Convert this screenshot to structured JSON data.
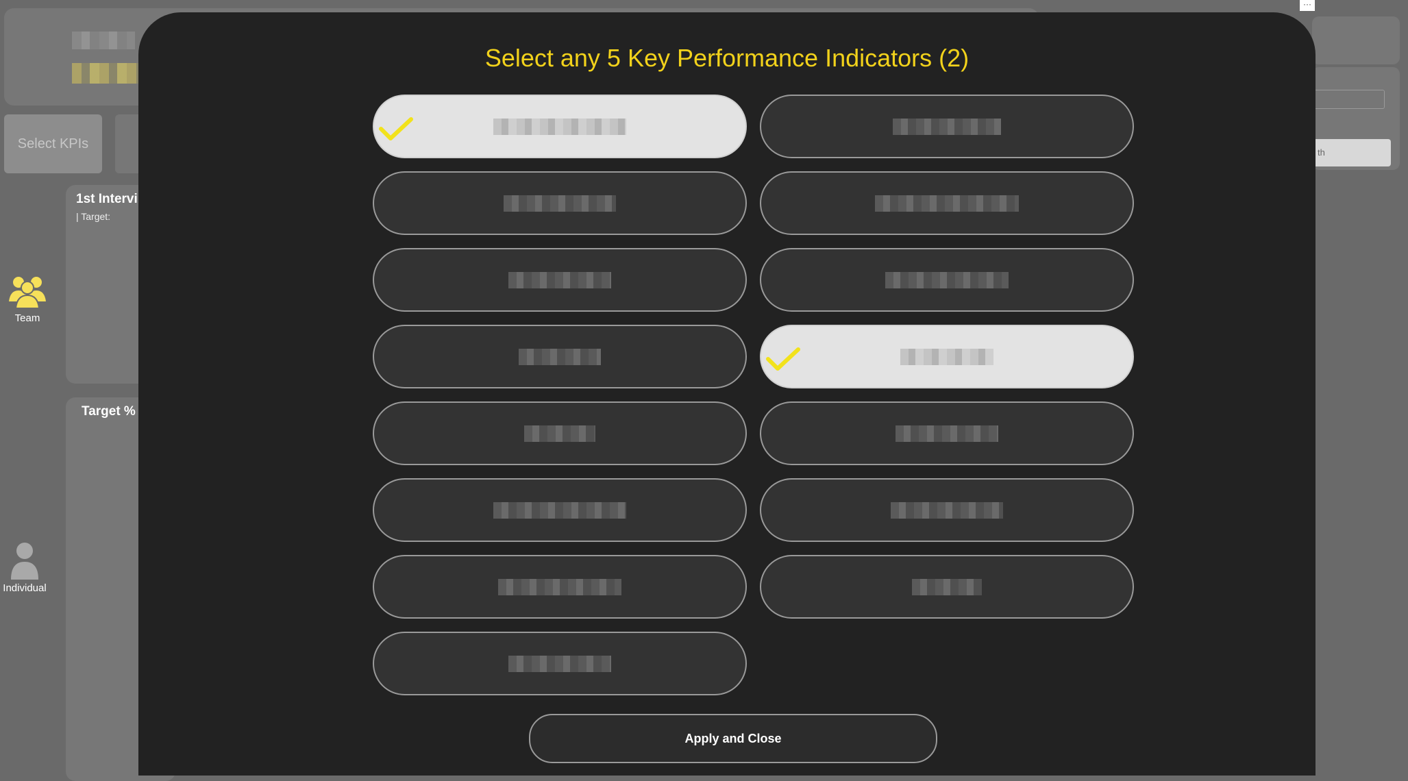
{
  "background": {
    "select_kpis_label": "Select KPIs",
    "card1_title": "1st Intervi",
    "card1_sub": "|  Target:",
    "card2_title": "Target %",
    "nav": [
      {
        "label": "Team",
        "icon": "team-icon"
      },
      {
        "label": "Individual",
        "icon": "person-icon"
      }
    ],
    "right_button_text": "th",
    "more_label": "···"
  },
  "modal": {
    "title": "Select any 5 Key Performance Indicators (2)",
    "apply_label": "Apply and Close",
    "accent_color": "#f2d21b",
    "kpis": [
      {
        "label": "KPI option 1",
        "selected": true
      },
      {
        "label": "KPI option 2",
        "selected": false
      },
      {
        "label": "KPI option 3",
        "selected": false
      },
      {
        "label": "KPI option 4",
        "selected": false
      },
      {
        "label": "KPI option 5",
        "selected": false
      },
      {
        "label": "KPI option 6",
        "selected": false
      },
      {
        "label": "KPI option 7",
        "selected": false
      },
      {
        "label": "KPI option 8",
        "selected": true
      },
      {
        "label": "KPI option 9",
        "selected": false
      },
      {
        "label": "KPI option 10",
        "selected": false
      },
      {
        "label": "KPI option 11",
        "selected": false
      },
      {
        "label": "KPI option 12",
        "selected": false
      },
      {
        "label": "KPI option 13",
        "selected": false
      },
      {
        "label": "KPI option 14",
        "selected": false
      },
      {
        "label": "KPI option 15",
        "selected": false
      }
    ]
  }
}
